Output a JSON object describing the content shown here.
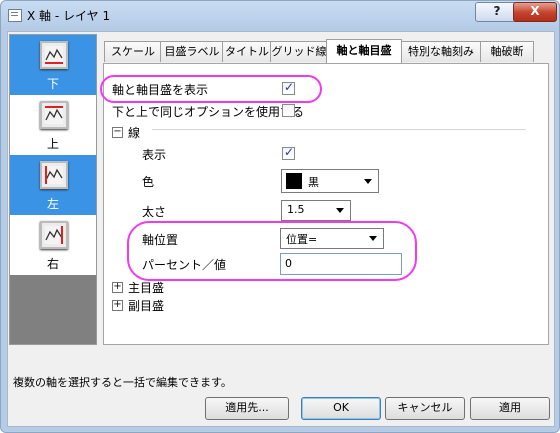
{
  "window": {
    "title": "X 軸 - レイヤ 1",
    "help_label": "?",
    "close_label": "X"
  },
  "axes": [
    {
      "label": "下",
      "selected": true
    },
    {
      "label": "上",
      "selected": false
    },
    {
      "label": "左",
      "selected": true
    },
    {
      "label": "右",
      "selected": false
    }
  ],
  "tabs": [
    "スケール",
    "目盛ラベル",
    "タイトル",
    "グリッド線",
    "軸と軸目盛",
    "特別な軸刻み",
    "軸破断"
  ],
  "active_tab": "軸と軸目盛",
  "options": {
    "show_axis_ticks": "軸と軸目盛を表示",
    "same_options_top_bottom": "下と上で同じオプションを使用する"
  },
  "line_section": {
    "toggle": "−",
    "title": "線",
    "show_label": "表示",
    "color_label": "色",
    "color_value": "黒",
    "color_hex": "#000000",
    "thickness_label": "太さ",
    "thickness_value": "1.5",
    "axis_position_label": "軸位置",
    "axis_position_value": "位置=",
    "percent_value_label": "パーセント／値",
    "percent_value": "0"
  },
  "major_ticks": {
    "toggle": "+",
    "label": "主目盛"
  },
  "minor_ticks": {
    "toggle": "+",
    "label": "副目盛"
  },
  "status_text": "複数の軸を選択すると一括で編集できます。",
  "buttons": {
    "apply_to": "適用先...",
    "ok": "OK",
    "cancel": "キャンセル",
    "apply": "適用"
  },
  "check_mark": "✓",
  "colors": {
    "highlight_oval": "#ef3af0",
    "selected_axis": "#3a93e5"
  }
}
